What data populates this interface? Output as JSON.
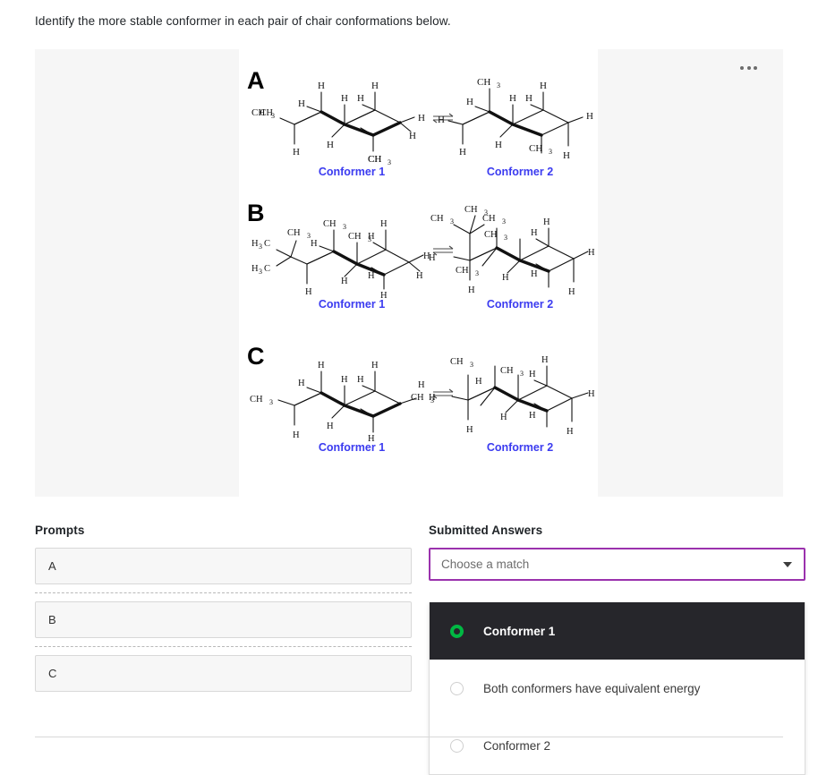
{
  "question": {
    "text": "Identify the more stable conformer in each pair of chair conformations below."
  },
  "figure": {
    "menu_icon": "ellipsis-horizontal-icon",
    "rows": [
      {
        "letter": "A",
        "left_label": "Conformer 1",
        "right_label": "Conformer 2",
        "arrow": "equilibrium-arrow",
        "left_substituents": [
          "CH3",
          "CH3"
        ],
        "right_substituents": [
          "CH3",
          "CH3"
        ],
        "left_hydrogens": [
          "H",
          "H",
          "H",
          "H",
          "H",
          "H",
          "H",
          "H"
        ],
        "right_hydrogens": [
          "H",
          "H",
          "H",
          "H",
          "H",
          "H",
          "H",
          "H"
        ]
      },
      {
        "letter": "B",
        "left_label": "Conformer 1",
        "right_label": "Conformer 2",
        "arrow": "equilibrium-arrow",
        "left_substituents": [
          "H3C",
          "H3C",
          "CH3",
          "CH3",
          "CH3"
        ],
        "right_substituents": [
          "CH3",
          "CH3",
          "CH3",
          "CH3",
          "CH3"
        ],
        "left_hydrogens": [
          "H",
          "H",
          "H",
          "H",
          "H",
          "H",
          "H",
          "H"
        ],
        "right_hydrogens": [
          "H",
          "H",
          "H",
          "H",
          "H",
          "H",
          "H",
          "H"
        ]
      },
      {
        "letter": "C",
        "left_label": "Conformer 1",
        "right_label": "Conformer 2",
        "arrow": "equilibrium-arrow",
        "left_substituents": [
          "CH3",
          "CH3"
        ],
        "right_substituents": [
          "CH3",
          "CH3"
        ],
        "left_hydrogens": [
          "H",
          "H",
          "H",
          "H",
          "H",
          "H",
          "H",
          "H"
        ],
        "right_hydrogens": [
          "H",
          "H",
          "H",
          "H",
          "H",
          "H",
          "H",
          "H"
        ]
      }
    ]
  },
  "prompts": {
    "heading": "Prompts",
    "items": [
      {
        "label": "A"
      },
      {
        "label": "B"
      },
      {
        "label": "C"
      }
    ]
  },
  "answers": {
    "heading": "Submitted Answers",
    "select": {
      "placeholder": "Choose a match",
      "value": "",
      "caret_icon": "chevron-down-icon",
      "border_color": "#9b32ad",
      "expanded": true
    },
    "options": [
      {
        "label": "Conformer 1",
        "selected": true
      },
      {
        "label": "Both conformers have equivalent energy",
        "selected": false
      },
      {
        "label": "Conformer 2",
        "selected": false
      }
    ],
    "highlight_color": "#26262b",
    "radio_selected_color": "#00b843"
  },
  "colors": {
    "conformer_label": "#3b3bf0",
    "panel_gray": "#f6f6f6",
    "prompt_cell_bg": "#f7f7f7"
  }
}
